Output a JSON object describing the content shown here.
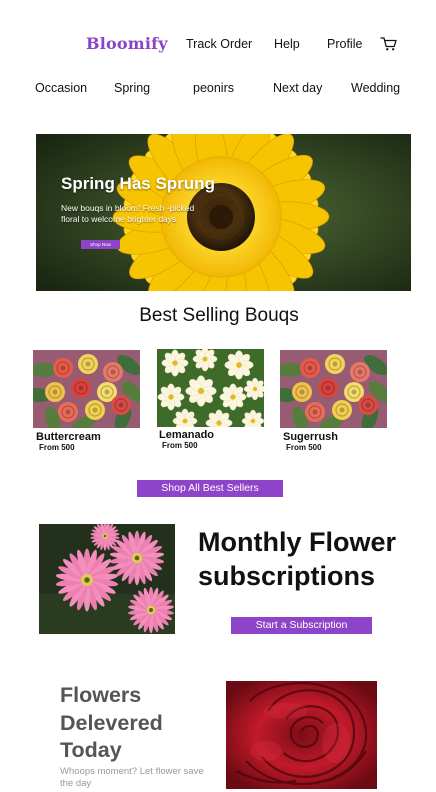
{
  "header": {
    "brand": "Bloomify",
    "nav": [
      "Track Order",
      "Help",
      "Profile"
    ],
    "cart_icon": "shopping-cart-icon"
  },
  "categories": [
    "Occasion",
    "Spring",
    "peonirs",
    "Next day",
    "Wedding"
  ],
  "hero": {
    "title": "Spring Has Sprung",
    "subtitle": "New bouqs in bloom! Fresh -picked floral to welcome brighter days",
    "button": "Shop Now"
  },
  "best_sellers": {
    "title": "Best Selling Bouqs",
    "products": [
      {
        "name": "Buttercream",
        "price": "From 500"
      },
      {
        "name": "Lemanado",
        "price": "From 500"
      },
      {
        "name": "Sugerrush",
        "price": "From 500"
      }
    ],
    "button": "Shop All Best Sellers"
  },
  "subscriptions": {
    "title_line1": "Monthly Flower",
    "title_line2": "subscriptions",
    "button": "Start a Subscription"
  },
  "delivery": {
    "title_line1": "Flowers",
    "title_line2": "Delevered",
    "title_line3": "Today",
    "subtitle": "Whoops moment? Let flower save the day"
  },
  "colors": {
    "brand": "#8a44c4",
    "button": "#8e44c8"
  }
}
